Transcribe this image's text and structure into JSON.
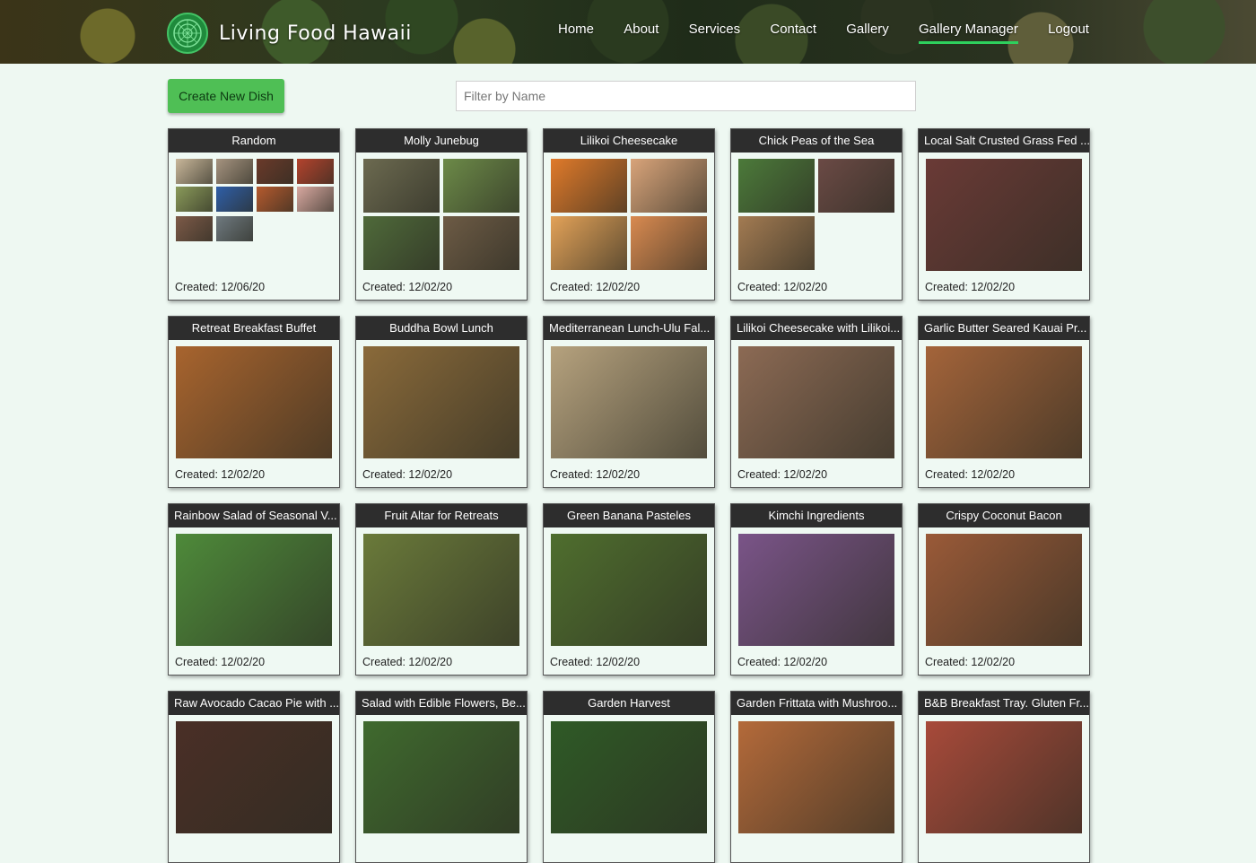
{
  "brand": {
    "name": "Living Food Hawaii"
  },
  "nav": [
    {
      "label": "Home"
    },
    {
      "label": "About"
    },
    {
      "label": "Services"
    },
    {
      "label": "Contact"
    },
    {
      "label": "Gallery"
    },
    {
      "label": "Gallery Manager",
      "active": true
    },
    {
      "label": "Logout"
    }
  ],
  "toolbar": {
    "create_label": "Create New Dish",
    "filter_placeholder": "Filter by Name",
    "filter_value": ""
  },
  "colors": {
    "accent_green": "#4fbf55",
    "card_header": "#2d2d2d",
    "page_bg": "#eef8f2"
  },
  "dishes": [
    {
      "title": "Random",
      "created": "Created: 12/06/20",
      "layout": "mini",
      "images": [
        "#c9b79a",
        "#a69480",
        "#6b3a2a",
        "#b4432d",
        "#8a9a5a",
        "#2f5fa8",
        "#b55a2e",
        "#d8a8a0",
        "#7d5a48",
        "#6f7a80"
      ]
    },
    {
      "title": "Molly Junebug",
      "created": "Created: 12/02/20",
      "layout": "quad",
      "images": [
        "#6c6a50",
        "#6c8a48",
        "#4f6a3a",
        "#6d5b45"
      ]
    },
    {
      "title": "Lilikoi Cheesecake",
      "created": "Created: 12/02/20",
      "layout": "quad",
      "images": [
        "#e07a2a",
        "#d9a47a",
        "#e3a258",
        "#d98a50"
      ]
    },
    {
      "title": "Chick Peas of the Sea",
      "created": "Created: 12/02/20",
      "layout": "tri",
      "images": [
        "#4c7a3a",
        "#6b4a45",
        "#a37b52"
      ]
    },
    {
      "title": "Local Salt Crusted Grass Fed ...",
      "created": "Created: 12/02/20",
      "layout": "single",
      "images": [
        "#6a3a36"
      ]
    },
    {
      "title": "Retreat Breakfast Buffet",
      "created": "Created: 12/02/20",
      "layout": "single",
      "images": [
        "#a8642e"
      ]
    },
    {
      "title": "Buddha Bowl Lunch",
      "created": "Created: 12/02/20",
      "layout": "single",
      "images": [
        "#8a6a3a"
      ]
    },
    {
      "title": "Mediterranean Lunch-Ulu Fal...",
      "created": "Created: 12/02/20",
      "layout": "single",
      "images": [
        "#b6a27e"
      ]
    },
    {
      "title": "Lilikoi Cheesecake with Lilikoi...",
      "created": "Created: 12/02/20",
      "layout": "single",
      "images": [
        "#8c6a54"
      ]
    },
    {
      "title": "Garlic Butter Seared Kauai Pr...",
      "created": "Created: 12/02/20",
      "layout": "single",
      "images": [
        "#a4643a"
      ]
    },
    {
      "title": "Rainbow Salad of Seasonal V...",
      "created": "Created: 12/02/20",
      "layout": "single",
      "images": [
        "#4e8a3a"
      ]
    },
    {
      "title": "Fruit Altar for Retreats",
      "created": "Created: 12/02/20",
      "layout": "single",
      "images": [
        "#6a7a3a"
      ]
    },
    {
      "title": "Green Banana Pasteles",
      "created": "Created: 12/02/20",
      "layout": "single",
      "images": [
        "#4f6e2e"
      ]
    },
    {
      "title": "Kimchi Ingredients",
      "created": "Created: 12/02/20",
      "layout": "single",
      "images": [
        "#7a5488"
      ]
    },
    {
      "title": "Crispy Coconut Bacon",
      "created": "Created: 12/02/20",
      "layout": "single",
      "images": [
        "#9a5a38"
      ]
    },
    {
      "title": "Raw Avocado Cacao Pie with ...",
      "created": "",
      "layout": "single",
      "images": [
        "#4a2f26"
      ]
    },
    {
      "title": "Salad with Edible Flowers, Be...",
      "created": "",
      "layout": "single",
      "images": [
        "#3f6a2e"
      ]
    },
    {
      "title": "Garden Harvest",
      "created": "",
      "layout": "single",
      "images": [
        "#2f5a26"
      ]
    },
    {
      "title": "Garden Frittata with Mushroo...",
      "created": "",
      "layout": "single",
      "images": [
        "#b46a3a"
      ]
    },
    {
      "title": "B&B Breakfast Tray. Gluten Fr...",
      "created": "",
      "layout": "single",
      "images": [
        "#a84a3a"
      ]
    }
  ]
}
